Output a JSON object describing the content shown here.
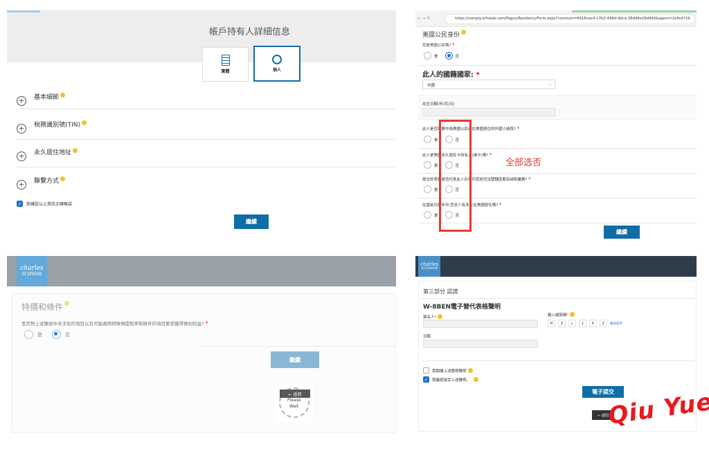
{
  "panel_top_left": {
    "title": "帳戶持有人詳細信息",
    "entity_tab": "實體",
    "individual_tab": "個人",
    "sections": [
      "基本細節",
      "稅務識別號(TIN)",
      "永久居住地址",
      "聯繫方式"
    ],
    "confirm_text": "我確認以上資訊正確無誤",
    "continue": "繼續"
  },
  "panel_top_right": {
    "url": "https://comply.schwab.com/Pages/ResidencyForm.aspx?common=6916cae4-17b2-448d-9dca-38d98e29d983&agent=2efed719-",
    "us_citizenship": "美國公民身份",
    "q_citizen": "您是美國公民嗎?",
    "yes": "是",
    "no": "否",
    "nationality_label": "此人的國籍國家:",
    "nationality_value": "中國",
    "dob_label": "出生日期(年/月/日)",
    "q1": "此人是否需要作為美國公民或在美國居住的外國人納稅?",
    "q2": "此人是美國永久居民卡持有人(綠卡)嗎?",
    "q3": "提交的表格是否代表此人在任何其他司法管轄區都有納稅義務?",
    "q4": "在當前日曆年中,您至少有多天在美國居住嗎?",
    "annotation": "全部选否",
    "continue": "繼續"
  },
  "panel_bottom_left": {
    "logo_line1": "charles",
    "logo_line2": "SCHWAB",
    "title": "特價和條件",
    "question": "是否對上述陳述中未涉及的項目以及可能適用特殊預提稅率和條件的項目要求獲得條約利益?",
    "yes": "是",
    "no": "否",
    "continue": "繼續",
    "back": "← 返回",
    "please": "Please",
    "wait": "Wait"
  },
  "panel_bottom_right": {
    "logo_line1": "charles",
    "logo_line2": "SCHWAB",
    "part": "第三部分 認證",
    "form_title": "W-8BEN電子替代表格聲明",
    "signer_label": "簽名人",
    "initials_label": "輸入縮寫碼",
    "initials": [
      "H",
      "Z",
      "L",
      "1",
      "K",
      "Z"
    ],
    "initials_link": "我的首字",
    "date_label": "日期",
    "read_statement": "我閱讀上述證明聲明",
    "confirm_statement": "我確認接受上述聲明。",
    "submit": "電子提交",
    "back": "← 返回"
  },
  "watermark": "Qiu Yue",
  "colors": {
    "brand_blue": "#0e6ea6",
    "annotation_red": "#e53935",
    "schwab_blue": "#64a9d9",
    "header_gray": "#9aa0a8",
    "header_dark": "#2f3d4b"
  }
}
